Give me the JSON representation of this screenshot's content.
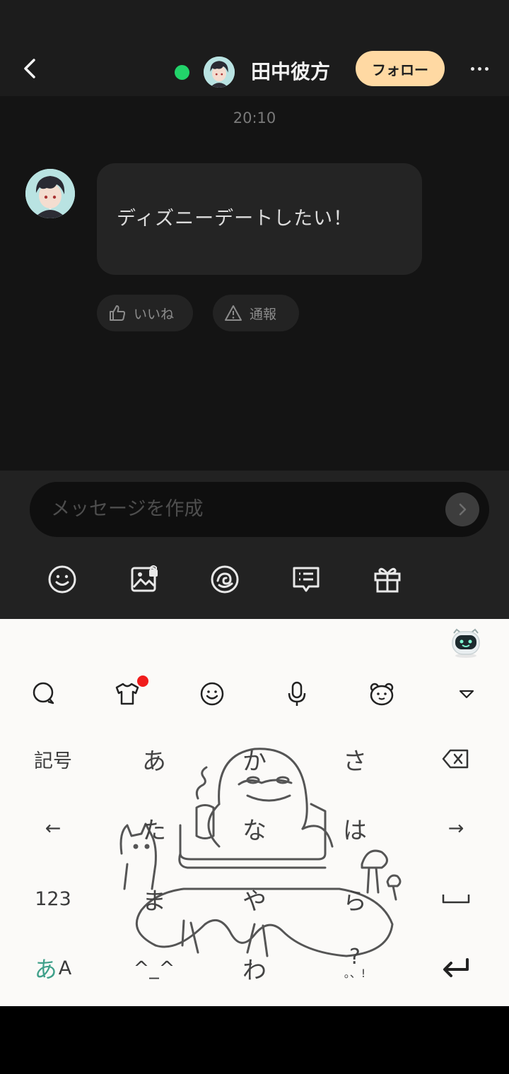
{
  "header": {
    "username": "田中彼方",
    "follow_label": "フォロー"
  },
  "chat": {
    "timestamp": "20:10",
    "message_text": "ディズニーデートしたい！",
    "like_label": "いいね",
    "report_label": "通報"
  },
  "composer": {
    "placeholder": "メッセージを作成"
  },
  "keyboard": {
    "rows": [
      [
        "記号",
        "あ",
        "か",
        "さ",
        "⌫"
      ],
      [
        "←",
        "た",
        "な",
        "は",
        "→"
      ],
      [
        "123",
        "ま",
        "や",
        "ら",
        "␣"
      ],
      [
        "あA",
        "^_^",
        "わ",
        "?。、!",
        "↵"
      ]
    ],
    "kigou": "記号",
    "a": "あ",
    "ka": "か",
    "sa": "さ",
    "left_arrow": "←",
    "ta": "た",
    "na": "な",
    "ha": "は",
    "right_arrow": "→",
    "num": "123",
    "ma": "ま",
    "ya": "や",
    "ra": "ら",
    "kana_a": "あ",
    "kana_A": "A",
    "emoticon": "^_^",
    "wa": "わ",
    "punct_top": "?",
    "punct_bottom": "。、!"
  },
  "colors": {
    "online": "#22d36a",
    "follow_bg": "#ffd9a3",
    "notification": "#f01c1c",
    "kana_accent": "#3fa08a"
  }
}
